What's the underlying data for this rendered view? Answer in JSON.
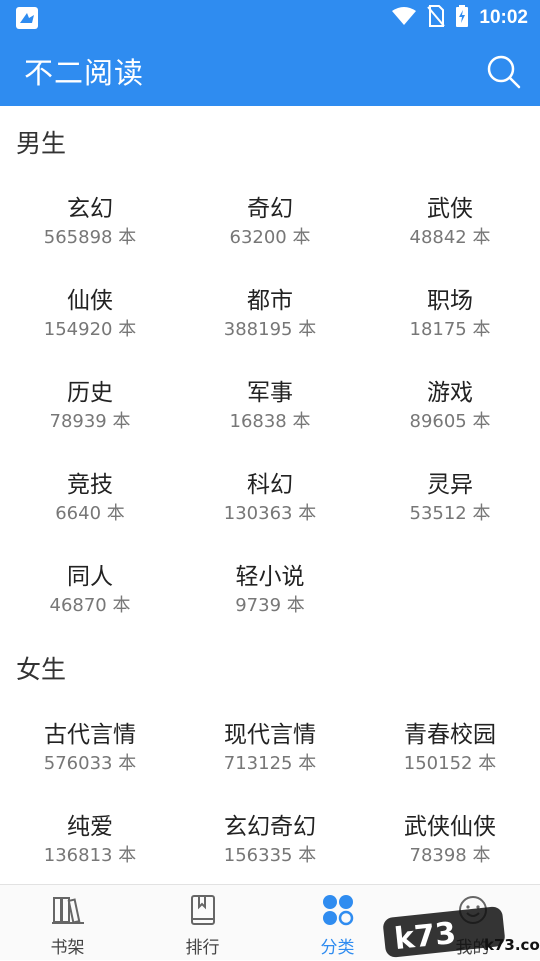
{
  "status_bar": {
    "time": "10:02"
  },
  "app": {
    "title": "不二阅读"
  },
  "sections": [
    {
      "title": "男生",
      "items": [
        {
          "name": "玄幻",
          "count": "565898 本"
        },
        {
          "name": "奇幻",
          "count": "63200 本"
        },
        {
          "name": "武侠",
          "count": "48842 本"
        },
        {
          "name": "仙侠",
          "count": "154920 本"
        },
        {
          "name": "都市",
          "count": "388195 本"
        },
        {
          "name": "职场",
          "count": "18175 本"
        },
        {
          "name": "历史",
          "count": "78939 本"
        },
        {
          "name": "军事",
          "count": "16838 本"
        },
        {
          "name": "游戏",
          "count": "89605 本"
        },
        {
          "name": "竞技",
          "count": "6640 本"
        },
        {
          "name": "科幻",
          "count": "130363 本"
        },
        {
          "name": "灵异",
          "count": "53512 本"
        },
        {
          "name": "同人",
          "count": "46870 本"
        },
        {
          "name": "轻小说",
          "count": "9739 本"
        }
      ]
    },
    {
      "title": "女生",
      "items": [
        {
          "name": "古代言情",
          "count": "576033 本"
        },
        {
          "name": "现代言情",
          "count": "713125 本"
        },
        {
          "name": "青春校园",
          "count": "150152 本"
        },
        {
          "name": "纯爱",
          "count": "136813 本"
        },
        {
          "name": "玄幻奇幻",
          "count": "156335 本"
        },
        {
          "name": "武侠仙侠",
          "count": "78398 本"
        }
      ]
    }
  ],
  "tabs": [
    {
      "label": "书架",
      "icon": "bookshelf-icon"
    },
    {
      "label": "排行",
      "icon": "book-icon"
    },
    {
      "label": "分类",
      "icon": "category-icon",
      "active": true
    },
    {
      "label": "我的",
      "icon": "profile-icon"
    }
  ],
  "watermark": {
    "text": "k73.com"
  },
  "colors": {
    "primary": "#2f8cf0",
    "text": "#222222",
    "muted": "#777777"
  }
}
